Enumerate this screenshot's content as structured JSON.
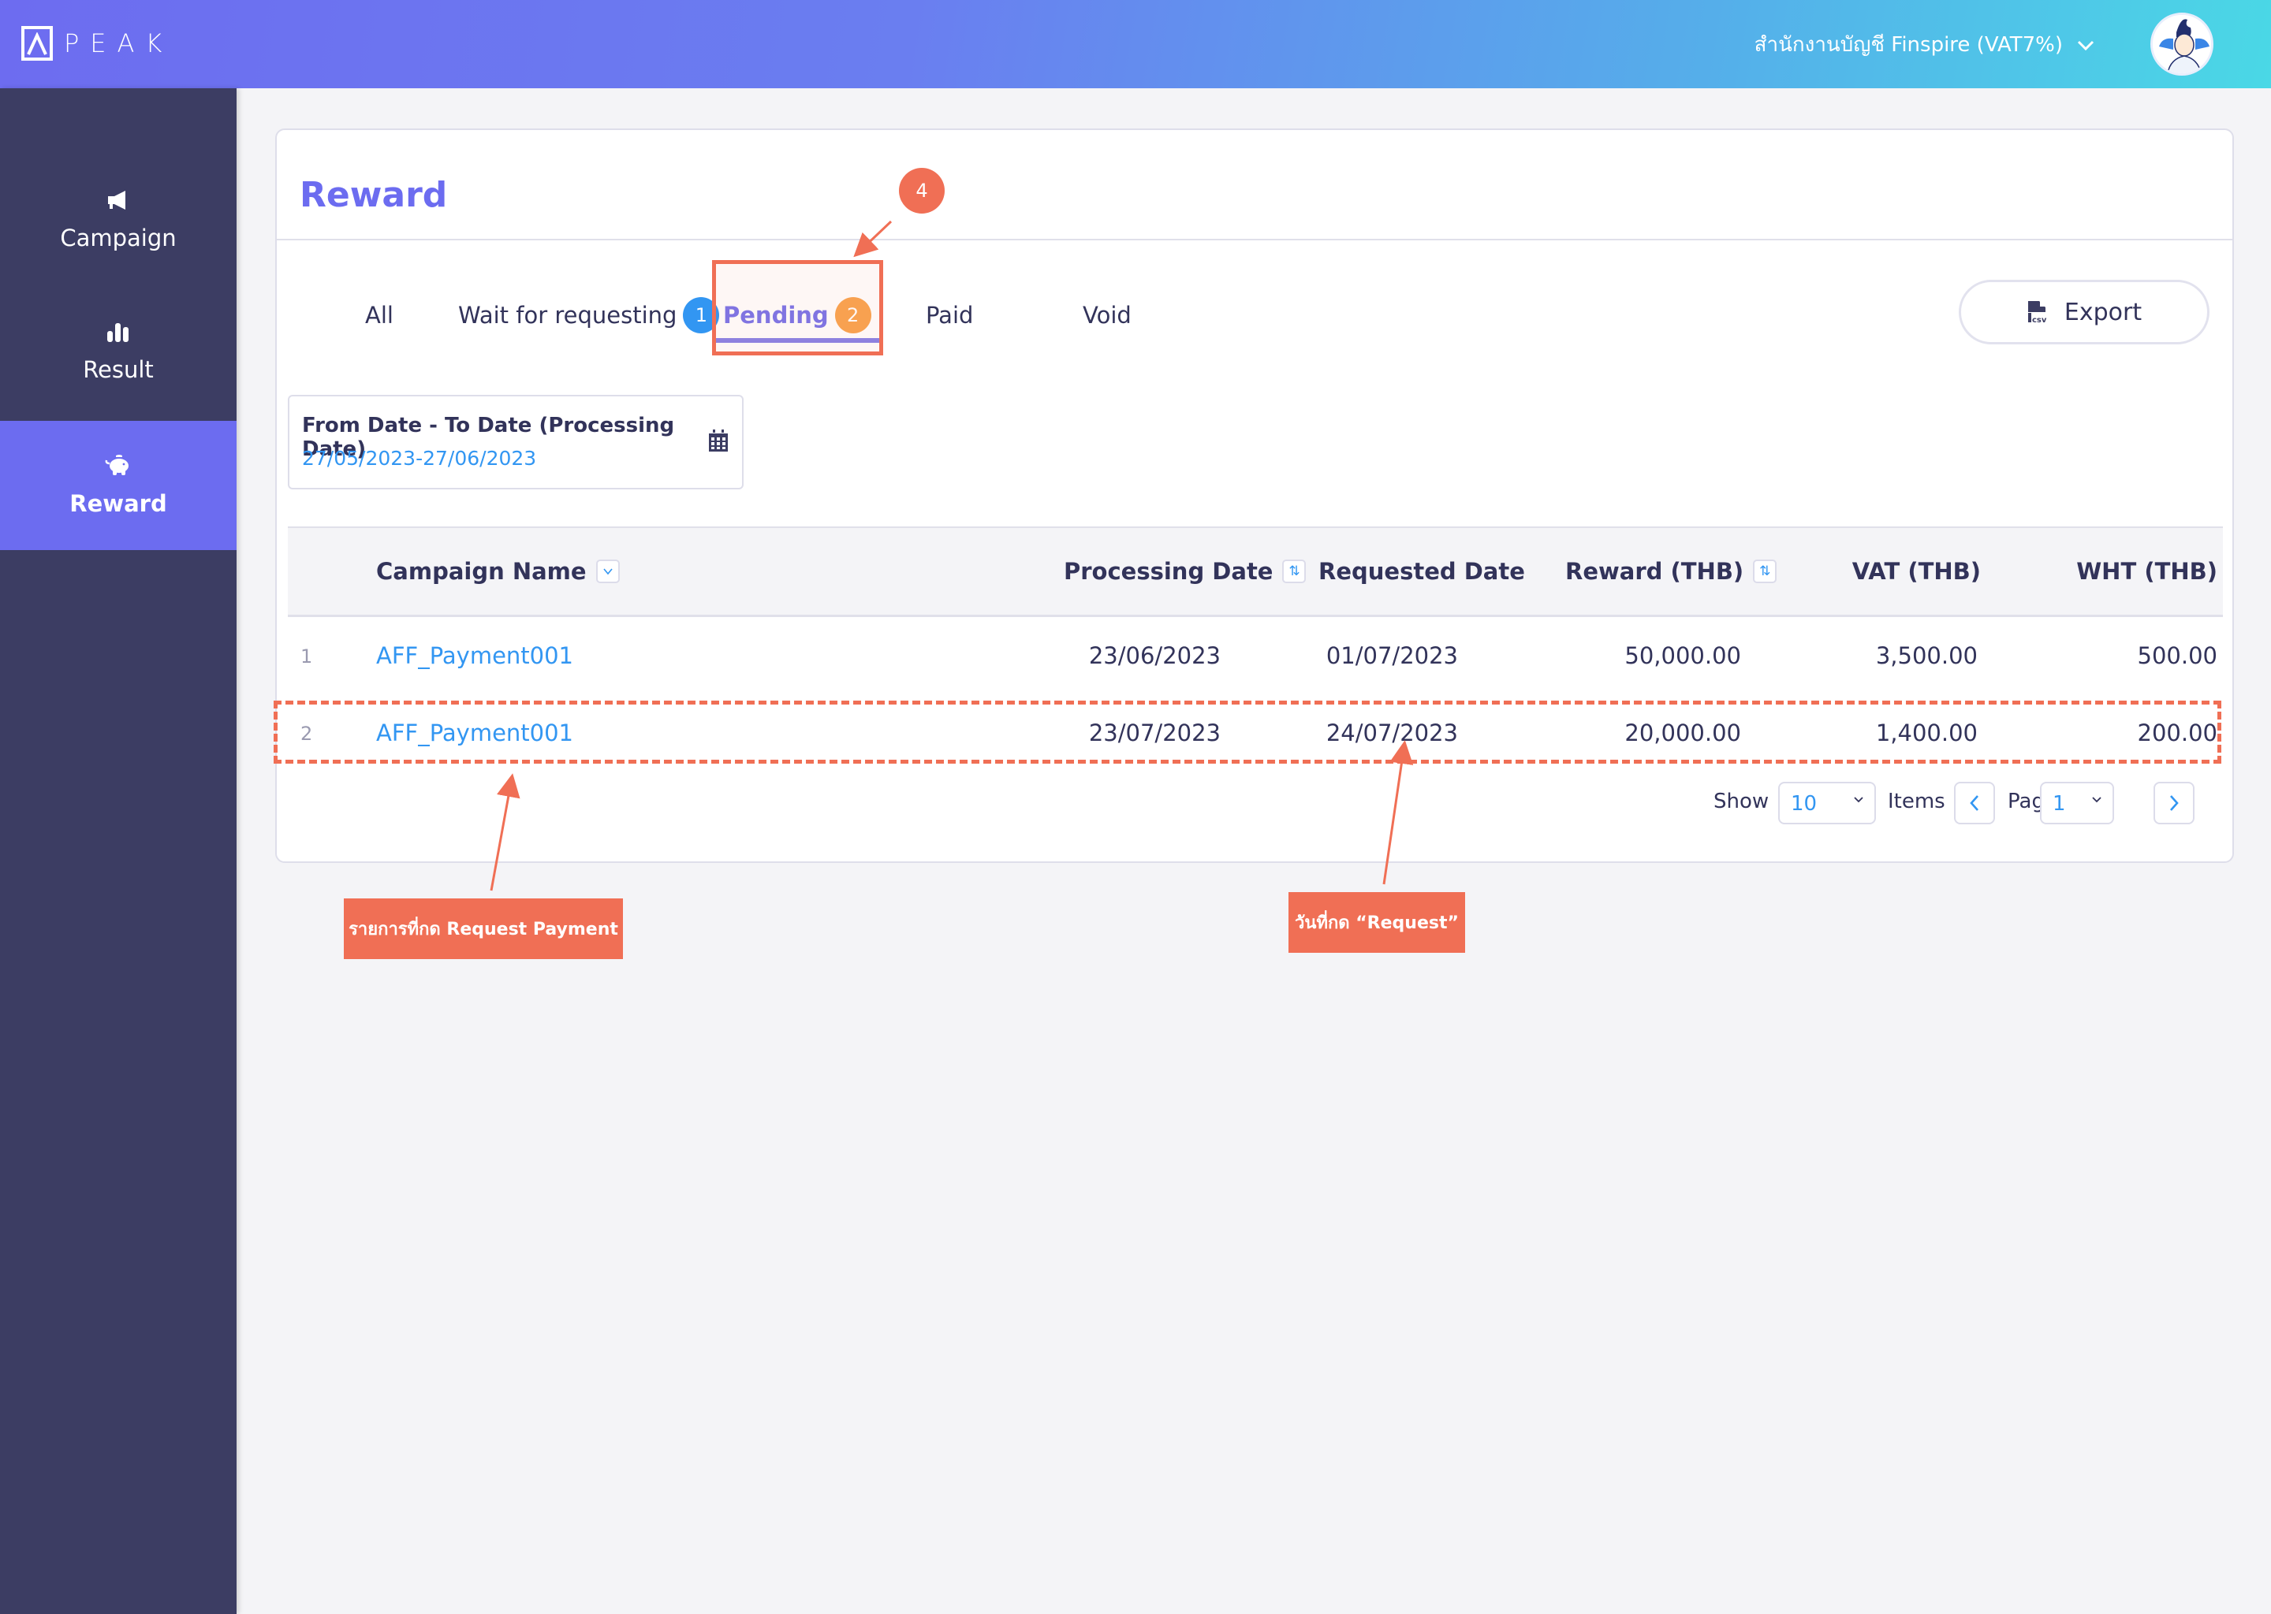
{
  "app": {
    "logo_text": "PEAK",
    "company_name": "สำนักงานบัญชี Finspire (VAT7%)"
  },
  "sidebar": {
    "items": [
      {
        "label": "Campaign",
        "icon": "megaphone-icon",
        "active": false
      },
      {
        "label": "Result",
        "icon": "bar-chart-icon",
        "active": false
      },
      {
        "label": "Reward",
        "icon": "piggy-bank-icon",
        "active": true
      }
    ]
  },
  "page": {
    "title": "Reward",
    "tabs": [
      {
        "label": "All",
        "badge": null,
        "active": false
      },
      {
        "label": "Wait for requesting",
        "badge": "1",
        "badge_color": "#3296f2",
        "active": false
      },
      {
        "label": "Pending",
        "badge": "2",
        "badge_color": "#f9a450",
        "active": true
      },
      {
        "label": "Paid",
        "badge": null,
        "active": false
      },
      {
        "label": "Void",
        "badge": null,
        "active": false
      }
    ],
    "export_label": "Export",
    "date_filter": {
      "label": "From Date - To Date (Processing Date)",
      "value": "27/05/2023-27/06/2023"
    }
  },
  "table": {
    "columns": [
      {
        "label": "Campaign Name",
        "control": "dropdown"
      },
      {
        "label": "Processing Date",
        "control": "sort"
      },
      {
        "label": "Requested Date",
        "control": null
      },
      {
        "label": "Reward (THB)",
        "control": "sort"
      },
      {
        "label": "VAT (THB)",
        "control": null
      },
      {
        "label": "WHT (THB)",
        "control": null
      }
    ],
    "rows": [
      {
        "no": "1",
        "campaign": "AFF_Payment001",
        "processing_date": "23/06/2023",
        "requested_date": "01/07/2023",
        "reward": "50,000.00",
        "vat": "3,500.00",
        "wht": "500.00"
      },
      {
        "no": "2",
        "campaign": "AFF_Payment001",
        "processing_date": "23/07/2023",
        "requested_date": "24/07/2023",
        "reward": "20,000.00",
        "vat": "1,400.00",
        "wht": "200.00"
      }
    ]
  },
  "pagination": {
    "show_label": "Show",
    "items_per_page": "10",
    "items_label": "Items",
    "page_label": "Page",
    "page": "1"
  },
  "annotations": {
    "step_number": "4",
    "label_row": "รายการที่กด Request Payment",
    "label_date": "วันที่กด “Request”",
    "color": "#f06f55"
  }
}
